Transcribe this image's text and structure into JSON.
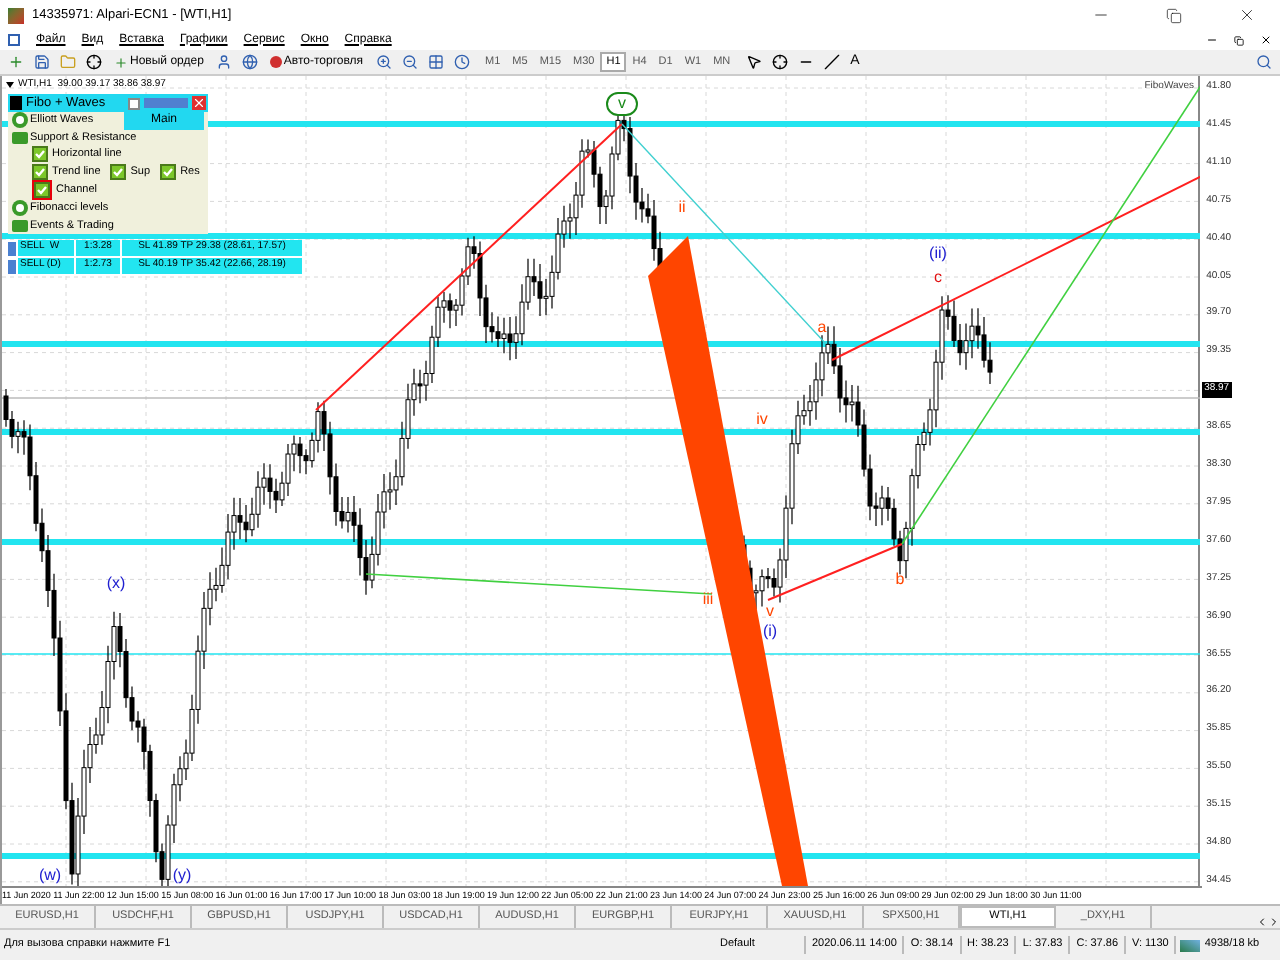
{
  "window": {
    "title": "14335971: Alpari-ECN1 - [WTI,H1]"
  },
  "menu": [
    "Файл",
    "Вид",
    "Вставка",
    "Графики",
    "Сервис",
    "Окно",
    "Справка"
  ],
  "toolbar": {
    "buttons": [
      {
        "label": "Новый ордер"
      },
      {
        "label": "Авто-торговля"
      }
    ],
    "timeframes": [
      {
        "label": "M1",
        "selected": false
      },
      {
        "label": "M5",
        "selected": false
      },
      {
        "label": "M15",
        "selected": false
      },
      {
        "label": "M30",
        "selected": false
      },
      {
        "label": "H1",
        "selected": true
      },
      {
        "label": "H4",
        "selected": false
      },
      {
        "label": "D1",
        "selected": false
      },
      {
        "label": "W1",
        "selected": false
      },
      {
        "label": "MN",
        "selected": false
      }
    ],
    "text_tool": "A"
  },
  "chart": {
    "header": "WTI,H1  39.00 39.17 38.86 38.97",
    "indicator_label": "FiboWaves",
    "price_axis": [
      {
        "text": "41.80",
        "current": false
      },
      {
        "text": "41.45",
        "current": false
      },
      {
        "text": "41.10",
        "current": false
      },
      {
        "text": "40.75",
        "current": false
      },
      {
        "text": "40.40",
        "current": false
      },
      {
        "text": "40.05",
        "current": false
      },
      {
        "text": "39.70",
        "current": false
      },
      {
        "text": "39.35",
        "current": false
      },
      {
        "text": "38.97",
        "current": true
      },
      {
        "text": "38.65",
        "current": false
      },
      {
        "text": "38.30",
        "current": false
      },
      {
        "text": "37.95",
        "current": false
      },
      {
        "text": "37.60",
        "current": false
      },
      {
        "text": "37.25",
        "current": false
      },
      {
        "text": "36.90",
        "current": false
      },
      {
        "text": "36.55",
        "current": false
      },
      {
        "text": "36.20",
        "current": false
      },
      {
        "text": "35.85",
        "current": false
      },
      {
        "text": "35.50",
        "current": false
      },
      {
        "text": "35.15",
        "current": false
      },
      {
        "text": "34.80",
        "current": false
      },
      {
        "text": "34.45",
        "current": false
      }
    ],
    "time_axis": [
      "11 Jun 2020",
      "11 Jun 22:00",
      "12 Jun 15:00",
      "15 Jun 08:00",
      "16 Jun 01:00",
      "16 Jun 17:00",
      "17 Jun 10:00",
      "18 Jun 03:00",
      "18 Jun 19:00",
      "19 Jun 12:00",
      "22 Jun 05:00",
      "22 Jun 21:00",
      "23 Jun 14:00",
      "24 Jun 07:00",
      "24 Jun 23:00",
      "25 Jun 16:00",
      "26 Jun 09:00",
      "29 Jun 02:00",
      "29 Jun 18:00",
      "30 Jun 11:00"
    ],
    "wave_labels": [
      {
        "text": "v",
        "color": "#1a8a1a",
        "circled": true
      },
      {
        "text": "ii",
        "color": "#ff4500",
        "circled": false
      },
      {
        "text": "iv",
        "color": "#ff4500",
        "circled": false
      },
      {
        "text": "iii",
        "color": "#ff4500",
        "circled": false
      },
      {
        "text": "v",
        "color": "#ff4500",
        "circled": false
      },
      {
        "text": "(i)",
        "color": "#2020d0",
        "circled": false
      },
      {
        "text": "a",
        "color": "#ff4500",
        "circled": false
      },
      {
        "text": "(ii)",
        "color": "#2020d0",
        "circled": false
      },
      {
        "text": "c",
        "color": "#e01010",
        "circled": false
      },
      {
        "text": "b",
        "color": "#ff4500",
        "circled": false
      },
      {
        "text": "(x)",
        "color": "#2020d0",
        "circled": false
      },
      {
        "text": "(w)",
        "color": "#2020d0",
        "circled": false
      },
      {
        "text": "(y)",
        "color": "#2020d0",
        "circled": false
      }
    ]
  },
  "panel": {
    "title": "Fibo + Waves",
    "checked": false,
    "sections": [
      {
        "label": "Elliott Waves",
        "expanded": false,
        "mode": "Main"
      },
      {
        "label": "Support & Resistance",
        "expanded": true,
        "rows": [
          [
            {
              "label": "Horizontal line",
              "checked": true,
              "highlighted": false
            }
          ],
          [
            {
              "label": "Trend line",
              "checked": true,
              "highlighted": false
            },
            {
              "label": "Sup",
              "checked": true,
              "highlighted": false
            },
            {
              "label": "Res",
              "checked": true,
              "highlighted": false
            }
          ],
          [
            {
              "label": "Channel",
              "checked": true,
              "highlighted": true
            }
          ]
        ]
      },
      {
        "label": "Fibonacci levels",
        "expanded": false
      },
      {
        "label": "Events & Trading",
        "expanded": true
      }
    ],
    "trades": [
      {
        "signal": "SELL  W",
        "ratio": "1:3.28",
        "levels": "SL 41.89 TP 29.38 (28.61, 17.57)"
      },
      {
        "signal": "SELL (D)",
        "ratio": "1:2.73",
        "levels": "SL 40.19 TP 35.42 (22.66, 28.19)"
      }
    ]
  },
  "tabs": [
    {
      "label": "EURUSD,H1",
      "selected": false
    },
    {
      "label": "USDCHF,H1",
      "selected": false
    },
    {
      "label": "GBPUSD,H1",
      "selected": false
    },
    {
      "label": "USDJPY,H1",
      "selected": false
    },
    {
      "label": "USDCAD,H1",
      "selected": false
    },
    {
      "label": "AUDUSD,H1",
      "selected": false
    },
    {
      "label": "EURGBP,H1",
      "selected": false
    },
    {
      "label": "EURJPY,H1",
      "selected": false
    },
    {
      "label": "XAUUSD,H1",
      "selected": false
    },
    {
      "label": "SPX500,H1",
      "selected": false
    },
    {
      "label": "WTI,H1",
      "selected": true
    },
    {
      "label": "_DXY,H1",
      "selected": false
    }
  ],
  "status_bar": {
    "help": "Для вызова справки нажмите F1",
    "profile": "Default",
    "time": "2020.06.11 14:00",
    "open": "O: 38.14",
    "high": "H: 38.23",
    "low": "L: 37.83",
    "close": "C: 37.86",
    "volume": "V: 1130",
    "traffic": "4938/18 kb"
  }
}
